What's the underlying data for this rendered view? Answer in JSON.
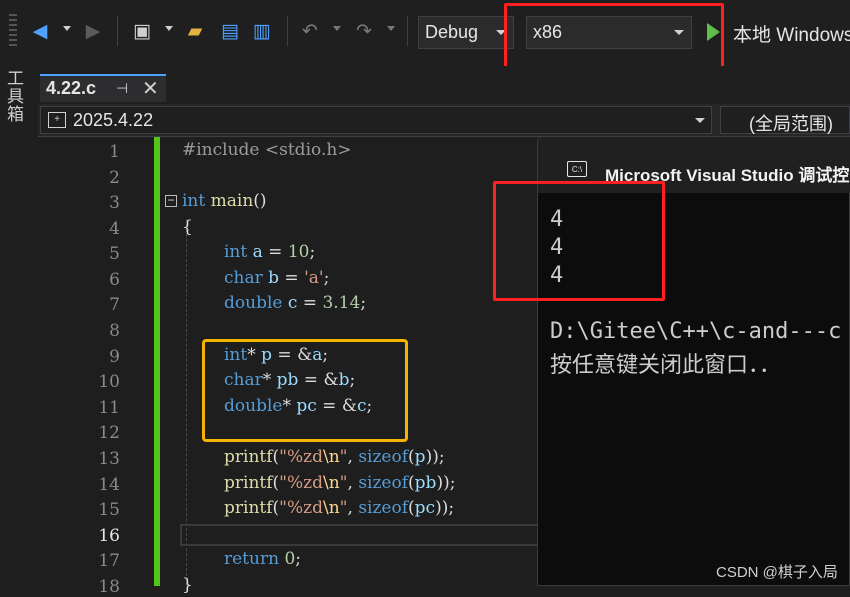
{
  "toolbar": {
    "config": "Debug",
    "platform": "x86",
    "run_label": "本地 Windows"
  },
  "side_toolbox": "工具箱",
  "tab": {
    "name": "4.22.c",
    "pin": "⊣",
    "close": "✕"
  },
  "navbar": {
    "project": "2025.4.22",
    "scope": "(全局范围)"
  },
  "editor": {
    "line_numbers": [
      "1",
      "2",
      "3",
      "4",
      "5",
      "6",
      "7",
      "8",
      "9",
      "10",
      "11",
      "12",
      "13",
      "14",
      "15",
      "16",
      "17",
      "18"
    ],
    "current_line": "16"
  },
  "console": {
    "title": "Microsoft Visual Studio 调试控",
    "output": [
      "4",
      "4",
      "4"
    ],
    "path": "D:\\Gitee\\C++\\c-and---c",
    "prompt": "按任意键关闭此窗口．．"
  },
  "watermark": "CSDN @棋子入局",
  "colors": {
    "highlight_red": "#ff2020",
    "highlight_orange": "#f5b400",
    "change_bar": "#52c41a"
  }
}
